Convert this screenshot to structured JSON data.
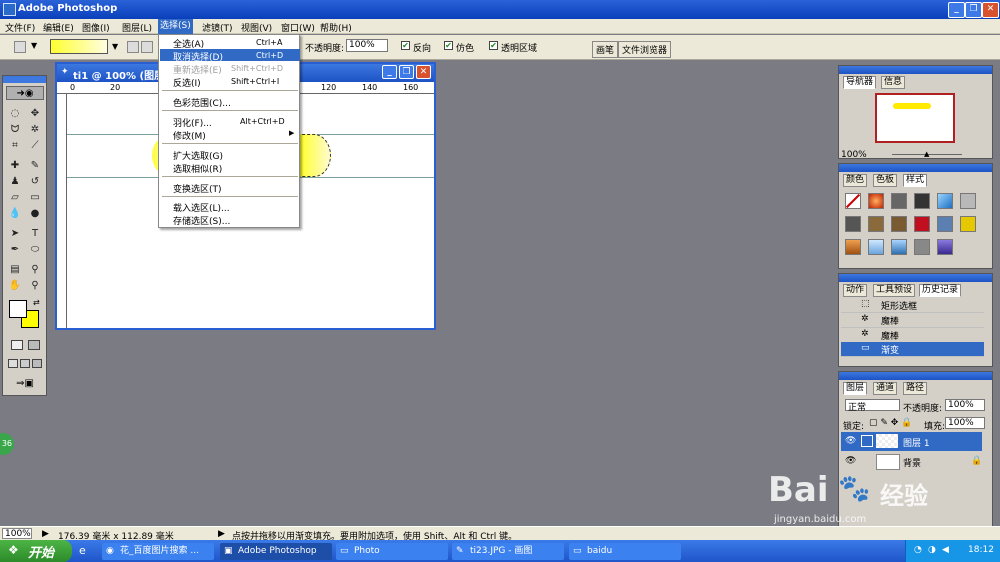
{
  "app": {
    "title": "Adobe Photoshop"
  },
  "menubar": {
    "items": [
      "文件(F)",
      "编辑(E)",
      "图像(I)",
      "图层(L)",
      "选择(S)",
      "滤镜(T)",
      "视图(V)",
      "窗口(W)",
      "帮助(H)"
    ]
  },
  "options": {
    "opacity_label": "不透明度:",
    "opacity_value": "100%",
    "reverse": "反向",
    "dither": "仿色",
    "transparency": "透明区域",
    "tab_brush": "画笔",
    "tab_browser": "文件浏览器"
  },
  "document": {
    "title": "ti1 @ 100% (图层",
    "ruler": [
      "0",
      "20",
      "120",
      "140",
      "160"
    ]
  },
  "select_menu": {
    "items": [
      {
        "label": "全选(A)",
        "shortcut": "Ctrl+A"
      },
      {
        "label": "取消选择(D)",
        "shortcut": "Ctrl+D"
      },
      {
        "label": "重新选择(E)",
        "shortcut": "Shift+Ctrl+D"
      },
      {
        "label": "反选(I)",
        "shortcut": "Shift+Ctrl+I"
      },
      {
        "label": "色彩范围(C)..."
      },
      {
        "label": "羽化(F)...",
        "shortcut": "Alt+Ctrl+D"
      },
      {
        "label": "修改(M)"
      },
      {
        "label": "扩大选取(G)"
      },
      {
        "label": "选取相似(R)"
      },
      {
        "label": "变换选区(T)"
      },
      {
        "label": "载入选区(L)..."
      },
      {
        "label": "存储选区(S)..."
      }
    ]
  },
  "navigator": {
    "tabs": [
      "导航器",
      "信息"
    ],
    "zoom": "100%"
  },
  "swatches": {
    "tabs": [
      "颜色",
      "色板",
      "样式"
    ]
  },
  "history": {
    "tabs": [
      "动作",
      "工具预设",
      "历史记录"
    ],
    "items": [
      "矩形选框",
      "魔棒",
      "魔棒",
      "渐变"
    ]
  },
  "layers": {
    "tabs": [
      "图层",
      "通道",
      "路径"
    ],
    "blend_mode": "正常",
    "opacity_label": "不透明度:",
    "opacity": "100%",
    "lock_label": "锁定:",
    "fill_label": "填充:",
    "fill": "100%",
    "items": [
      "图层 1",
      "背景"
    ]
  },
  "status": {
    "zoom": "100%",
    "dimensions": "176.39 毫米 x 112.89 毫米",
    "hint": "点按并拖移以用渐变填充。要用附加选项，使用 Shift、Alt 和 Ctrl 键。"
  },
  "taskbar": {
    "start": "开始",
    "tasks": [
      "花_百度图片搜索 ...",
      "Adobe Photoshop",
      "Photo",
      "ti23.JPG - 画图",
      "baidu"
    ],
    "time": "18:12"
  },
  "watermark": {
    "brand": "Bai",
    "sub": "经验",
    "url": "jingyan.baidu.com"
  },
  "misc": {
    "badge": "36"
  }
}
